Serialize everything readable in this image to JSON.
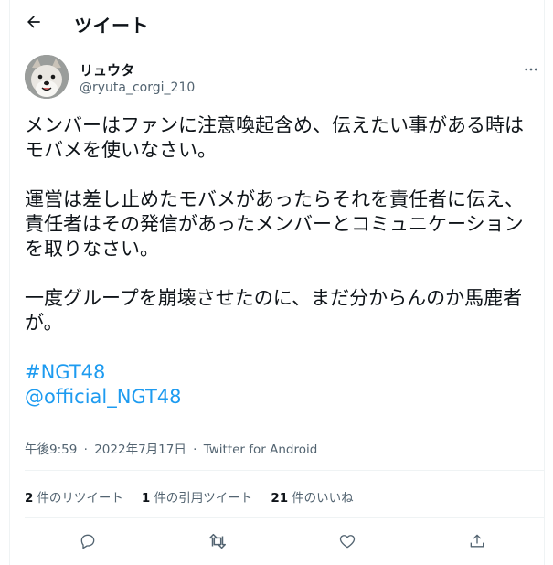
{
  "header": {
    "title": "ツイート",
    "back_icon": "arrow-left-icon"
  },
  "author": {
    "name": "リュウタ",
    "handle": "@ryuta_corgi_210"
  },
  "tweet": {
    "paragraph1": "メンバーはファンに注意喚起含め、伝えたい事がある時はモバメを使いなさい。",
    "paragraph2": "運営は差し止めたモバメがあったらそれを責任者に伝え、責任者はその発信があったメンバーとコミュニケーションを取りなさい。",
    "paragraph3": "一度グループを崩壊させたのに、まだ分からんのか馬鹿者が。",
    "hashtag": "#NGT48",
    "mention": "@official_NGT48"
  },
  "meta": {
    "time": "午後9:59",
    "date": "2022年7月17日",
    "client": "Twitter for Android",
    "separator": "·"
  },
  "stats": {
    "retweets_count": "2",
    "retweets_label": "件のリツイート",
    "quotes_count": "1",
    "quotes_label": "件の引用ツイート",
    "likes_count": "21",
    "likes_label": "件のいいね"
  },
  "actions": [
    "reply-icon",
    "retweet-icon",
    "like-icon",
    "share-icon"
  ],
  "colors": {
    "link": "#1d9bf0",
    "secondary_text": "#536471",
    "divider": "#eff3f4"
  }
}
